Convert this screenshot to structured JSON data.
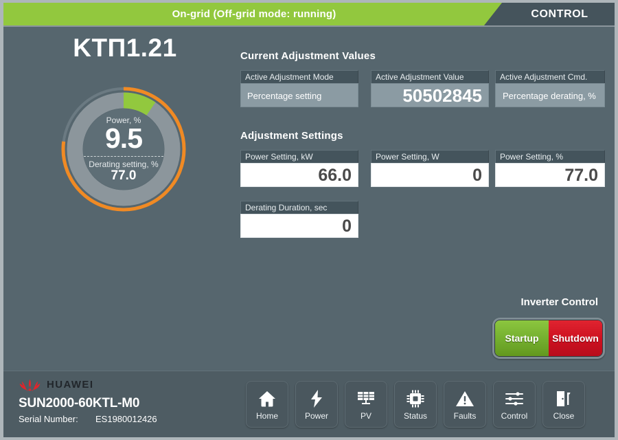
{
  "header": {
    "status_text": "On-grid (Off-grid mode: running)",
    "screen_name": "CONTROL",
    "green_color": "#92c83e",
    "bar_color": "#45545c"
  },
  "device": {
    "title": "KTП1.21"
  },
  "gauge": {
    "power_label": "Power, %",
    "power_value": "9.5",
    "derating_label": "Derating setting, %",
    "derating_value": "77.0",
    "power_percent": 9.5,
    "derating_percent": 77.0,
    "power_arc_color": "#92c83e",
    "derating_arc_color": "#f08a24",
    "ring_color": "#8c969c",
    "inner_color": "#5e6e76"
  },
  "current_adjustment": {
    "section_title": "Current Adjustment Values",
    "fields": [
      {
        "label": "Active Adjustment Mode",
        "value": "Percentage setting"
      },
      {
        "label": "Active Adjustment Value",
        "value": "50502845"
      },
      {
        "label": "Active Adjustment Cmd.",
        "value": "Percentage derating, %"
      }
    ]
  },
  "adjustment_settings": {
    "section_title": "Adjustment Settings",
    "fields": [
      {
        "label": "Power Setting, kW",
        "value": "66.0"
      },
      {
        "label": "Power Setting, W",
        "value": "0"
      },
      {
        "label": "Power Setting, %",
        "value": "77.0"
      },
      {
        "label": "Derating Duration, sec",
        "value": "0"
      }
    ]
  },
  "inverter_control": {
    "title": "Inverter Control",
    "startup_label": "Startup",
    "shutdown_label": "Shutdown",
    "startup_color": "#73ae2e",
    "shutdown_color": "#cc1020"
  },
  "brand": {
    "name": "HUAWEI",
    "logo_color": "#e3242b",
    "model": "SUN2000-60KTL-M0",
    "serial_label": "Serial Number:",
    "serial_value": "ES1980012426"
  },
  "toolbar": {
    "items": [
      {
        "label": "Home",
        "icon": "home-icon"
      },
      {
        "label": "Power",
        "icon": "lightning-bolt-icon"
      },
      {
        "label": "PV",
        "icon": "solar-panel-icon"
      },
      {
        "label": "Status",
        "icon": "chip-icon"
      },
      {
        "label": "Faults",
        "icon": "warning-triangle-icon"
      },
      {
        "label": "Control",
        "icon": "sliders-icon"
      },
      {
        "label": "Close",
        "icon": "exit-door-icon"
      }
    ]
  }
}
